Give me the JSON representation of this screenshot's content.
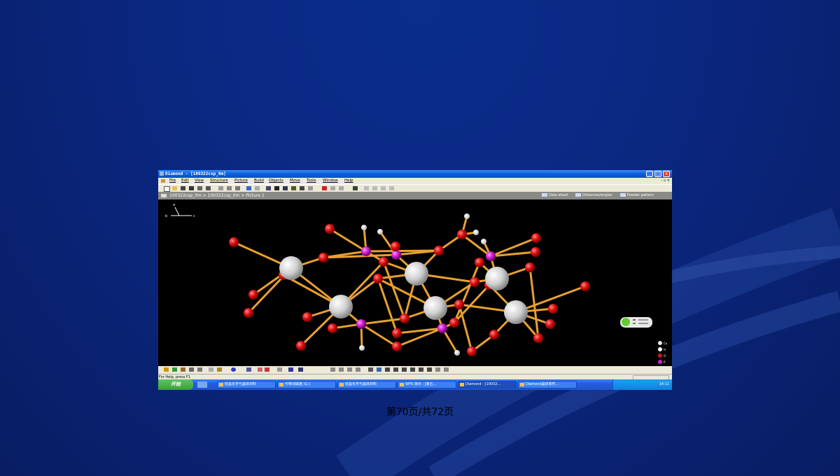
{
  "window": {
    "title": "Diamond - [100322csp_0m]",
    "menu": [
      "File",
      "Edit",
      "View",
      "Structure",
      "Picture",
      "Build",
      "Objects",
      "Move",
      "Tools",
      "Window",
      "Help"
    ],
    "mdi_controls": "- ▫ ×",
    "breadcrumb": "100322csp_0m > 100322csp_0m > Picture 1",
    "tabs": [
      "Data sheet",
      "Distances/angles",
      "Powder pattern"
    ],
    "status": "For Help, press F1"
  },
  "taskbar": {
    "start_label": "开始",
    "tasks": [
      "结晶化学与晶体材料",
      "可移动磁盘 (G:)",
      "结晶化学与晶体材料",
      "WPS 演示 - [第五...",
      "Diamond - [10032...",
      "Diamond晶体软件..."
    ],
    "clock": "14:11"
  },
  "legend": {
    "items": [
      {
        "label": "Cu",
        "color": "#e8e8e8"
      },
      {
        "label": "H",
        "color": "#ffffff"
      },
      {
        "label": "O",
        "color": "#e01010"
      },
      {
        "label": "P",
        "color": "#d020d0"
      }
    ]
  },
  "axes": {
    "labels": [
      "a",
      "b",
      "c"
    ]
  },
  "footer": {
    "page_label": "第70页/共72页"
  },
  "colors": {
    "bond": "#e8a030",
    "metal": "#e6e6e6",
    "oxygen": "#e01010",
    "phosphorus": "#d020d0",
    "hydrogen": "#ffffff"
  }
}
